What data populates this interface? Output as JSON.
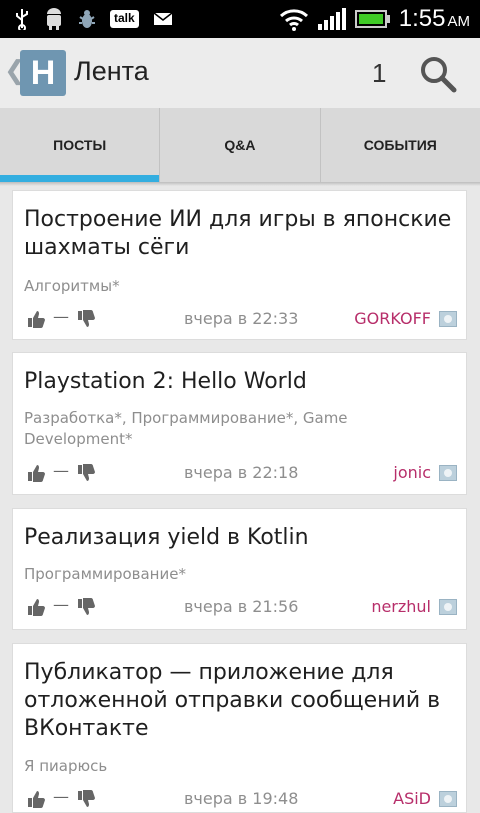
{
  "status_bar": {
    "icons": [
      "usb-icon",
      "android-debug-icon",
      "bug-icon",
      "talk-icon",
      "mail-icon",
      "wifi-icon",
      "signal-icon",
      "battery-icon"
    ],
    "talk_label": "talk",
    "time": "1:55",
    "ampm": "AM"
  },
  "action_bar": {
    "logo_letter": "H",
    "title": "Лента",
    "count": "1"
  },
  "tabs": [
    {
      "label": "ПОСТЫ",
      "active": true
    },
    {
      "label": "Q&A",
      "active": false
    },
    {
      "label": "СОБЫТИЯ",
      "active": false
    }
  ],
  "accent_color": "#33aee0",
  "author_color": "#b72e6a",
  "posts": [
    {
      "title": "Построение ИИ для игры в японские шахматы сёги",
      "hubs": "Алгоритмы*",
      "score": "—",
      "time": "вчера в 22:33",
      "author": "GORKOFF"
    },
    {
      "title": "Playstation 2: Hello World",
      "hubs": "Разработка*, Программирование*, Game Development*",
      "score": "—",
      "time": "вчера в 22:18",
      "author": "jonic"
    },
    {
      "title": "Реализация yield в Kotlin",
      "hubs": "Программирование*",
      "score": "—",
      "time": "вчера в 21:56",
      "author": "nerzhul"
    },
    {
      "title": "Публикатор — приложение для отложенной отправки сообщений в ВКонтакте",
      "hubs": "Я пиарюсь",
      "score": "—",
      "time": "вчера в 19:48",
      "author": "ASiD"
    }
  ]
}
